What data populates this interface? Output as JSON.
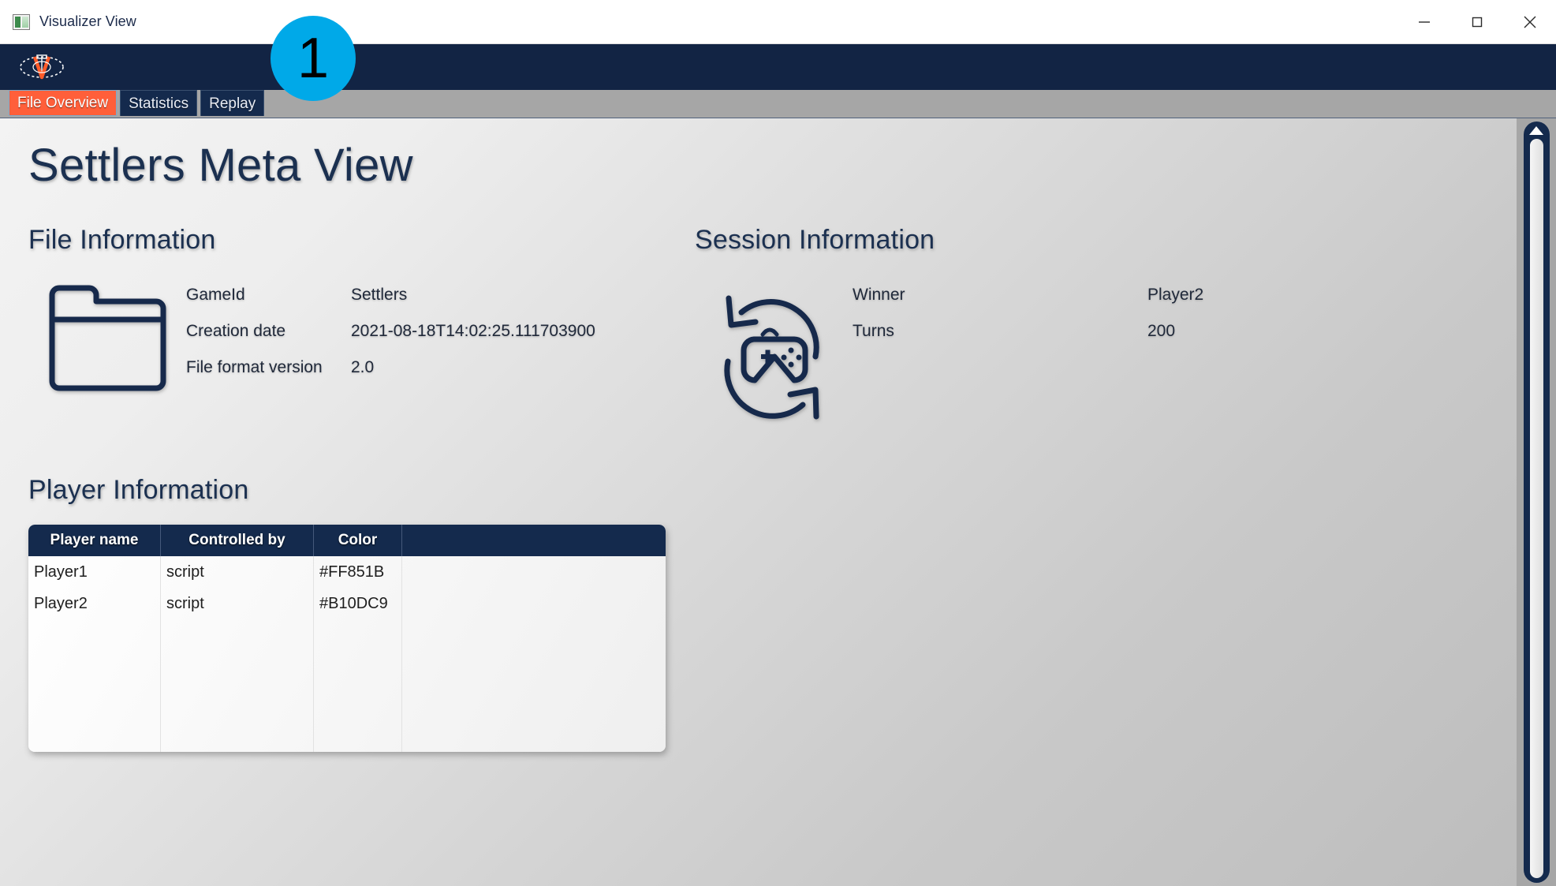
{
  "window": {
    "title": "Visualizer View",
    "app_icon": "app-window-icon",
    "controls": {
      "minimize": "minimize-icon",
      "maximize": "maximize-icon",
      "close": "close-icon"
    }
  },
  "header": {
    "logo": "visualizer-eye-v-logo"
  },
  "tabs": [
    {
      "label": "File Overview",
      "active": true
    },
    {
      "label": "Statistics",
      "active": false
    },
    {
      "label": "Replay",
      "active": false
    }
  ],
  "page": {
    "title": "Settlers Meta View"
  },
  "file_information": {
    "heading": "File Information",
    "icon": "folder-icon",
    "rows": [
      {
        "key": "GameId",
        "value": "Settlers"
      },
      {
        "key": "Creation date",
        "value": "2021-08-18T14:02:25.111703900"
      },
      {
        "key": "File format version",
        "value": "2.0"
      }
    ]
  },
  "session_information": {
    "heading": "Session Information",
    "icon": "gamepad-replay-icon",
    "rows": [
      {
        "key": "Winner",
        "value": "Player2"
      },
      {
        "key": "Turns",
        "value": "200"
      }
    ]
  },
  "player_information": {
    "heading": "Player Information",
    "columns": [
      "Player name",
      "Controlled by",
      "Color",
      ""
    ],
    "rows": [
      {
        "name": "Player1",
        "controlled_by": "script",
        "color": "#FF851B"
      },
      {
        "name": "Player2",
        "controlled_by": "script",
        "color": "#B10DC9"
      }
    ]
  },
  "scrollbar": {
    "up_arrow": "scroll-up-arrow-icon"
  },
  "annotation": {
    "badge_label": "1"
  },
  "colors": {
    "header_navy": "#122444",
    "tab_active_orange": "#FF5F3A",
    "tabstrip_gray": "#A6A6A6",
    "heading_navy": "#1B3050",
    "table_header_navy": "#142A4D",
    "badge_cyan": "#00A9E8",
    "player1_color": "#FF851B",
    "player2_color": "#B10DC9"
  }
}
